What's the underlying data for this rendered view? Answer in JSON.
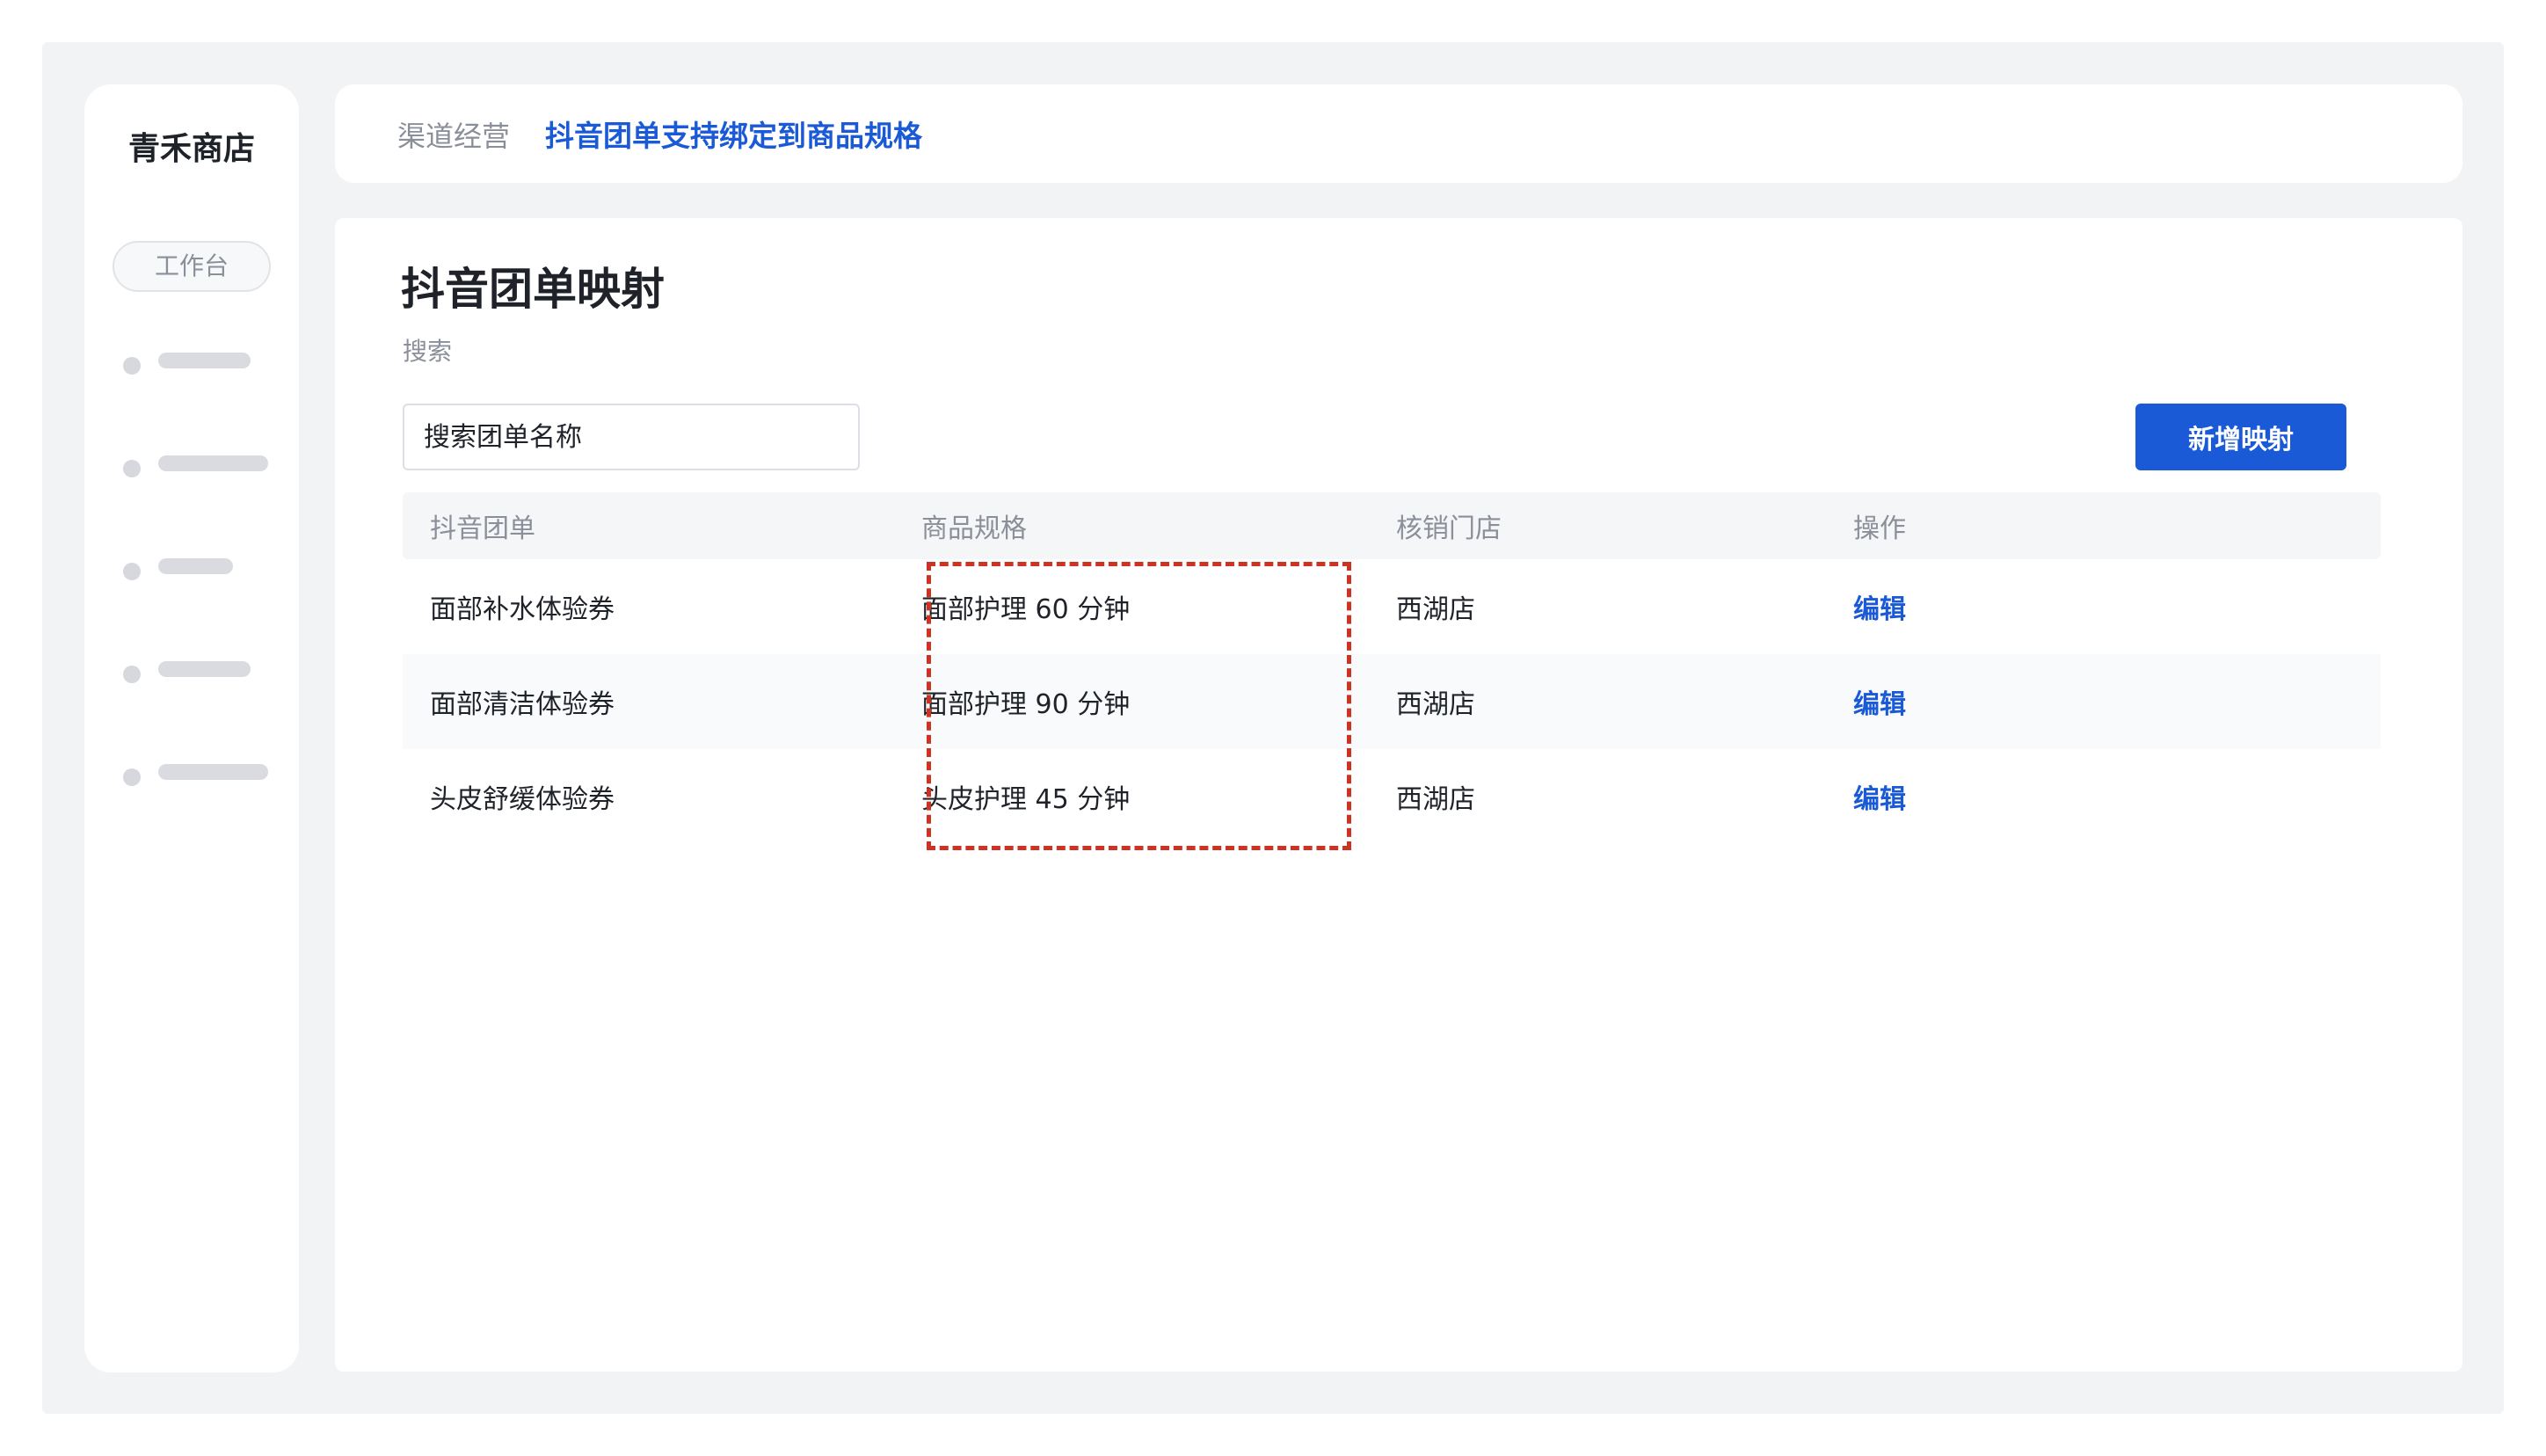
{
  "sidebar": {
    "brand": "青禾商店",
    "workspace_label": "工作台"
  },
  "header": {
    "breadcrumb_parent": "渠道经营",
    "breadcrumb_current": "抖音团单支持绑定到商品规格"
  },
  "main": {
    "title": "抖音团单映射",
    "search_label": "搜索",
    "search_placeholder": "搜索团单名称",
    "add_button_label": "新增映射"
  },
  "table": {
    "columns": [
      "抖音团单",
      "商品规格",
      "核销门店",
      "操作"
    ],
    "rows": [
      {
        "deal": "面部补水体验券",
        "spec": "面部护理 60 分钟",
        "store": "西湖店",
        "action": "编辑"
      },
      {
        "deal": "面部清洁体验券",
        "spec": "面部护理 90 分钟",
        "store": "西湖店",
        "action": "编辑"
      },
      {
        "deal": "头皮舒缓体验券",
        "spec": "头皮护理 45 分钟",
        "store": "西湖店",
        "action": "编辑"
      }
    ]
  },
  "colors": {
    "accent": "#1a5ad6",
    "highlight": "#cc3322"
  }
}
